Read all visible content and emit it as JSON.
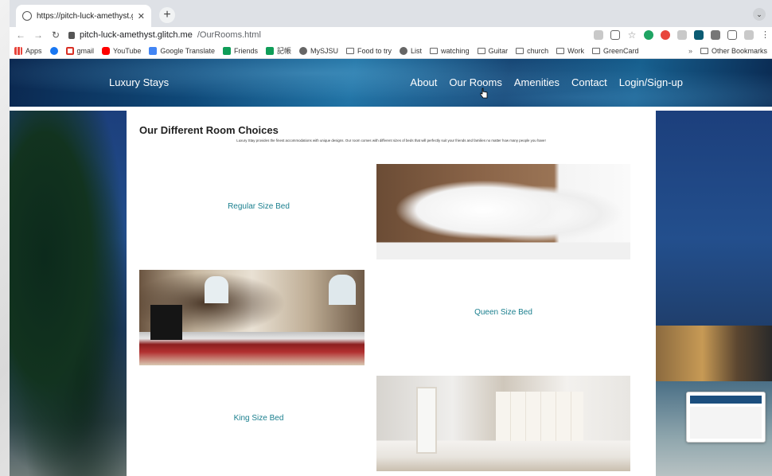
{
  "browser": {
    "tab_title": "https://pitch-luck-amethyst.gl",
    "new_tab_label": "+",
    "url_host": "pitch-luck-amethyst.glitch.me",
    "url_path": "/OurRooms.html"
  },
  "bookmarks": {
    "items": [
      {
        "label": "Apps",
        "icon": "apps-grid-icon"
      },
      {
        "label": "",
        "icon": "facebook-icon"
      },
      {
        "label": "gmail",
        "icon": "gmail-icon"
      },
      {
        "label": "YouTube",
        "icon": "youtube-icon"
      },
      {
        "label": "Google Translate",
        "icon": "google-translate-icon"
      },
      {
        "label": "Friends",
        "icon": "plus-square-icon"
      },
      {
        "label": "記帳",
        "icon": "plus-square-icon"
      },
      {
        "label": "MySJSU",
        "icon": "globe-icon"
      },
      {
        "label": "Food to try",
        "icon": "folder-icon"
      },
      {
        "label": "List",
        "icon": "globe-icon"
      },
      {
        "label": "watching",
        "icon": "folder-icon"
      },
      {
        "label": "Guitar",
        "icon": "folder-icon"
      },
      {
        "label": "church",
        "icon": "folder-icon"
      },
      {
        "label": "Work",
        "icon": "folder-icon"
      },
      {
        "label": "GreenCard",
        "icon": "folder-icon"
      }
    ],
    "overflow": "»",
    "other": "Other Bookmarks"
  },
  "site": {
    "brand": "Luxury Stays",
    "nav": [
      "About",
      "Our Rooms",
      "Amenities",
      "Contact",
      "Login/Sign-up"
    ]
  },
  "rooms_page": {
    "heading": "Our Different Room Choices",
    "intro": "Luxury Stay provides the finest accommodations with unique designs. Our room comes with different sizes of beds that will perfectly suit your friends and families no matter how many people you have!",
    "rooms": [
      {
        "label": "Regular Size Bed"
      },
      {
        "label": "Queen Size Bed"
      },
      {
        "label": "King Size Bed"
      }
    ]
  }
}
